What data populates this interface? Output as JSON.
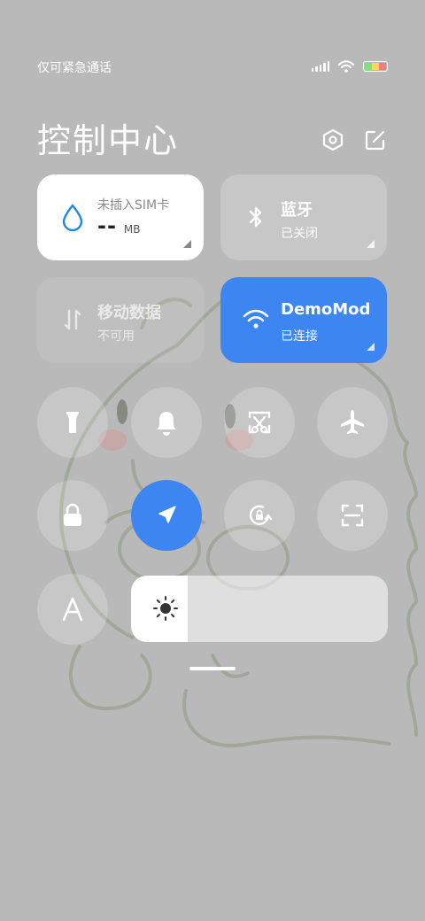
{
  "status_bar": {
    "carrier_text": "仅可紧急通话",
    "signal_icon": "signal-bars-icon",
    "wifi_icon": "wifi-icon",
    "battery_colors": [
      "#7fe07c",
      "#f7d95a",
      "#f27b7b"
    ]
  },
  "header": {
    "title": "控制中心",
    "settings_icon": "settings-hexagon-icon",
    "edit_icon": "edit-icon"
  },
  "tiles": {
    "data_usage": {
      "label": "未插入SIM卡",
      "value": "--",
      "unit": "MB",
      "icon": "water-drop-icon",
      "accent": "#1e88e5"
    },
    "bluetooth": {
      "label": "蓝牙",
      "status": "已关闭",
      "icon": "bluetooth-icon"
    },
    "mobile_data": {
      "label": "移动数据",
      "status": "不可用",
      "icon": "data-arrows-icon"
    },
    "wifi": {
      "label": "DemoMod",
      "status": "已连接",
      "icon": "wifi-icon",
      "color": "#3d85f0"
    }
  },
  "toggles": [
    {
      "name": "flashlight",
      "icon": "flashlight-icon",
      "active": false
    },
    {
      "name": "sound",
      "icon": "bell-icon",
      "active": false
    },
    {
      "name": "screenshot",
      "icon": "screenshot-scissors-icon",
      "active": false
    },
    {
      "name": "airplane-mode",
      "icon": "airplane-icon",
      "active": false
    },
    {
      "name": "lock-screen",
      "icon": "lock-icon",
      "active": false
    },
    {
      "name": "location",
      "icon": "location-arrow-icon",
      "active": true
    },
    {
      "name": "auto-rotate",
      "icon": "rotation-lock-icon",
      "active": false
    },
    {
      "name": "scanner",
      "icon": "scan-icon",
      "active": false
    },
    {
      "name": "reading-mode",
      "icon": "font-a-icon",
      "active": false
    }
  ],
  "brightness": {
    "level": 0.22,
    "icon": "sun-icon"
  }
}
